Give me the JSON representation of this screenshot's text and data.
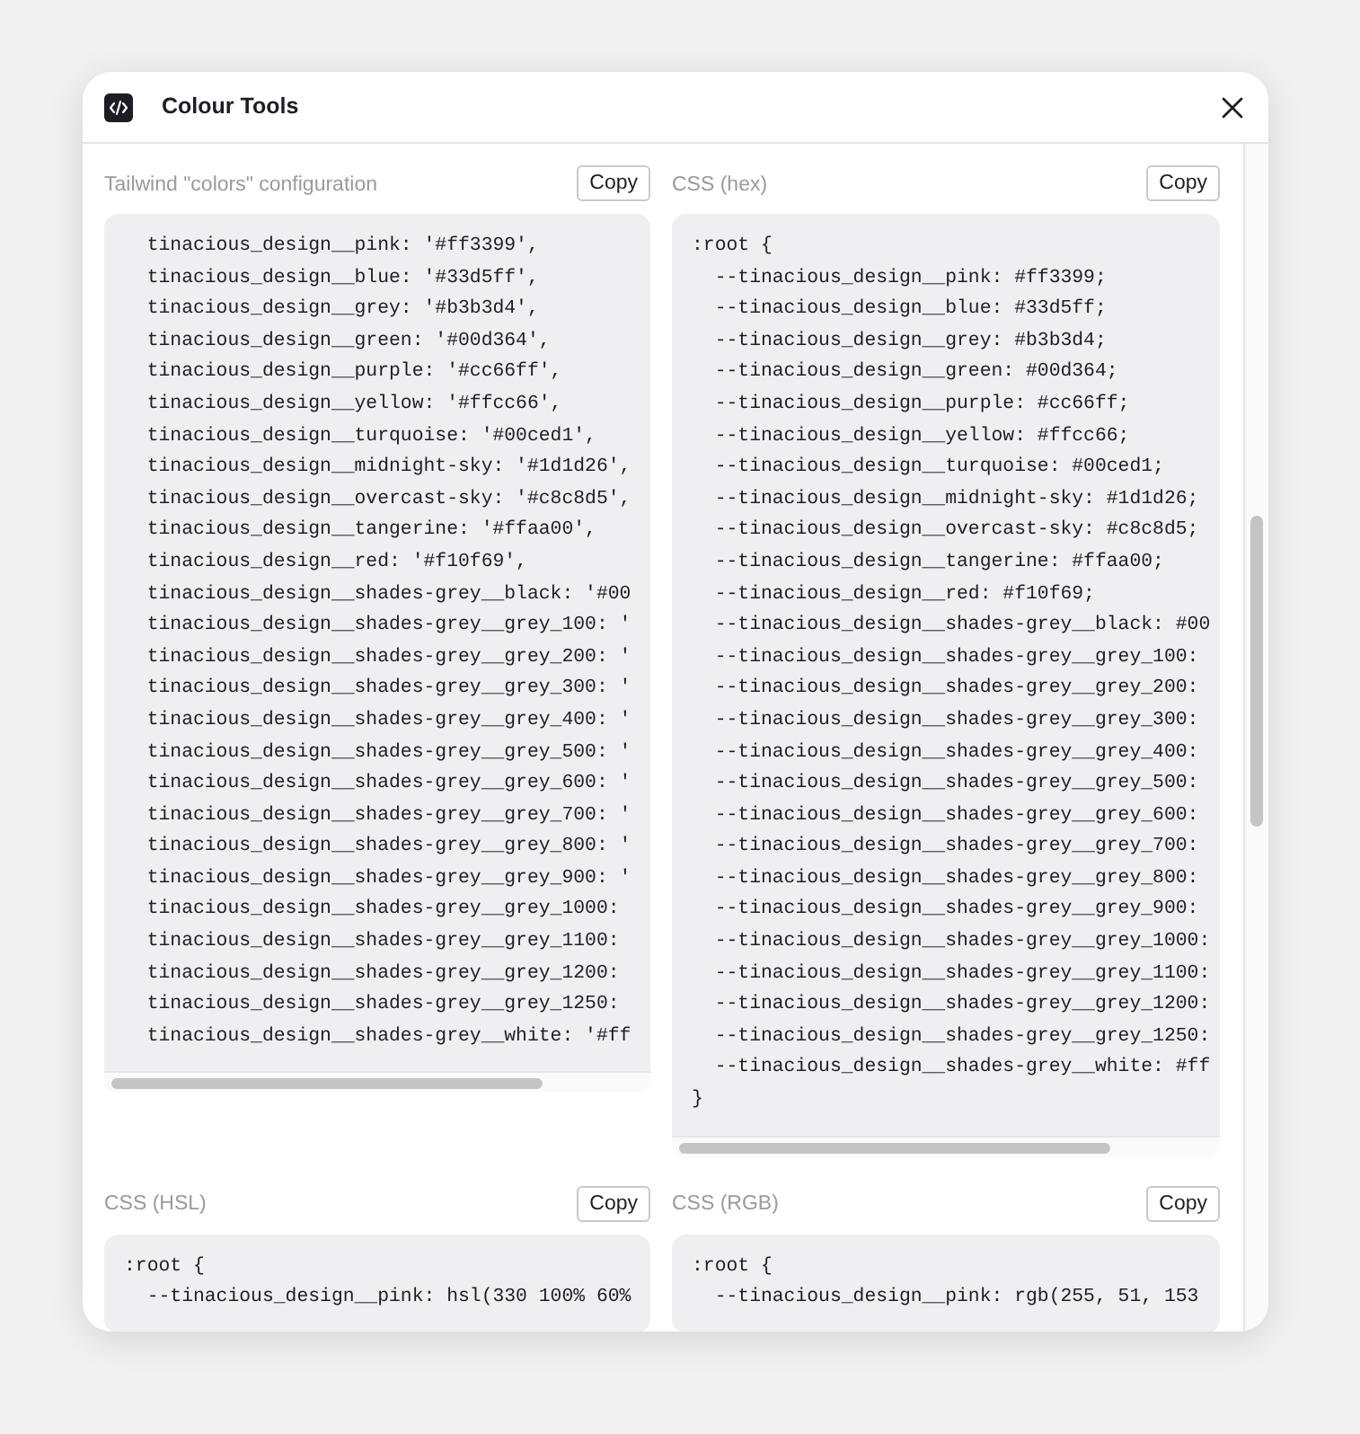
{
  "window": {
    "title": "Colour Tools"
  },
  "panels": [
    {
      "title": "Tailwind \"colors\" configuration",
      "button": "Copy",
      "lines": [
        "  tinacious_design__pink: '#ff3399',",
        "  tinacious_design__blue: '#33d5ff',",
        "  tinacious_design__grey: '#b3b3d4',",
        "  tinacious_design__green: '#00d364',",
        "  tinacious_design__purple: '#cc66ff',",
        "  tinacious_design__yellow: '#ffcc66',",
        "  tinacious_design__turquoise: '#00ced1',",
        "  tinacious_design__midnight-sky: '#1d1d26',",
        "  tinacious_design__overcast-sky: '#c8c8d5',",
        "  tinacious_design__tangerine: '#ffaa00',",
        "  tinacious_design__red: '#f10f69',",
        "  tinacious_design__shades-grey__black: '#00",
        "  tinacious_design__shades-grey__grey_100: '",
        "  tinacious_design__shades-grey__grey_200: '",
        "  tinacious_design__shades-grey__grey_300: '",
        "  tinacious_design__shades-grey__grey_400: '",
        "  tinacious_design__shades-grey__grey_500: '",
        "  tinacious_design__shades-grey__grey_600: '",
        "  tinacious_design__shades-grey__grey_700: '",
        "  tinacious_design__shades-grey__grey_800: '",
        "  tinacious_design__shades-grey__grey_900: '",
        "  tinacious_design__shades-grey__grey_1000:",
        "  tinacious_design__shades-grey__grey_1100:",
        "  tinacious_design__shades-grey__grey_1200:",
        "  tinacious_design__shades-grey__grey_1250:",
        "  tinacious_design__shades-grey__white: '#ff"
      ]
    },
    {
      "title": "CSS (hex)",
      "button": "Copy",
      "lines": [
        ":root {",
        "  --tinacious_design__pink: #ff3399;",
        "  --tinacious_design__blue: #33d5ff;",
        "  --tinacious_design__grey: #b3b3d4;",
        "  --tinacious_design__green: #00d364;",
        "  --tinacious_design__purple: #cc66ff;",
        "  --tinacious_design__yellow: #ffcc66;",
        "  --tinacious_design__turquoise: #00ced1;",
        "  --tinacious_design__midnight-sky: #1d1d26;",
        "  --tinacious_design__overcast-sky: #c8c8d5;",
        "  --tinacious_design__tangerine: #ffaa00;",
        "  --tinacious_design__red: #f10f69;",
        "  --tinacious_design__shades-grey__black: #00",
        "  --tinacious_design__shades-grey__grey_100:",
        "  --tinacious_design__shades-grey__grey_200:",
        "  --tinacious_design__shades-grey__grey_300:",
        "  --tinacious_design__shades-grey__grey_400:",
        "  --tinacious_design__shades-grey__grey_500:",
        "  --tinacious_design__shades-grey__grey_600:",
        "  --tinacious_design__shades-grey__grey_700:",
        "  --tinacious_design__shades-grey__grey_800:",
        "  --tinacious_design__shades-grey__grey_900:",
        "  --tinacious_design__shades-grey__grey_1000:",
        "  --tinacious_design__shades-grey__grey_1100:",
        "  --tinacious_design__shades-grey__grey_1200:",
        "  --tinacious_design__shades-grey__grey_1250:",
        "  --tinacious_design__shades-grey__white: #ff",
        "}"
      ]
    },
    {
      "title": "CSS (HSL)",
      "button": "Copy",
      "lines": [
        ":root {",
        "  --tinacious_design__pink: hsl(330 100% 60%"
      ]
    },
    {
      "title": "CSS (RGB)",
      "button": "Copy",
      "lines": [
        ":root {",
        "  --tinacious_design__pink: rgb(255, 51, 153"
      ]
    }
  ]
}
